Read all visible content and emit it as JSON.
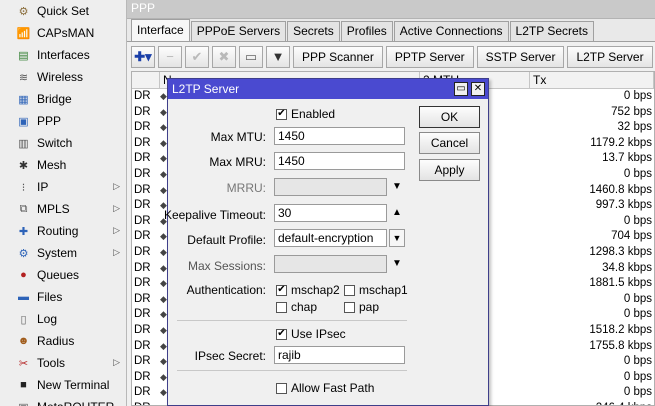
{
  "sidebar": {
    "items": [
      {
        "label": "Quick Set",
        "icon": "quick-set-icon",
        "glyph": "⚙",
        "color": "#8a6d3b",
        "arrow": false
      },
      {
        "label": "CAPsMAN",
        "icon": "capsman-icon",
        "glyph": "📶",
        "color": "#3a7a3a",
        "arrow": false
      },
      {
        "label": "Interfaces",
        "icon": "interfaces-icon",
        "glyph": "▤",
        "color": "#2f7d2f",
        "arrow": false
      },
      {
        "label": "Wireless",
        "icon": "wireless-icon",
        "glyph": "≋",
        "color": "#555555",
        "arrow": false
      },
      {
        "label": "Bridge",
        "icon": "bridge-icon",
        "glyph": "▦",
        "color": "#2d63b8",
        "arrow": false
      },
      {
        "label": "PPP",
        "icon": "ppp-icon",
        "glyph": "▣",
        "color": "#2d63b8",
        "arrow": false
      },
      {
        "label": "Switch",
        "icon": "switch-icon",
        "glyph": "▥",
        "color": "#555555",
        "arrow": false
      },
      {
        "label": "Mesh",
        "icon": "mesh-icon",
        "glyph": "✱",
        "color": "#333333",
        "arrow": false
      },
      {
        "label": "IP",
        "icon": "ip-icon",
        "glyph": "⁝",
        "color": "#555555",
        "arrow": true
      },
      {
        "label": "MPLS",
        "icon": "mpls-icon",
        "glyph": "⧉",
        "color": "#555555",
        "arrow": true
      },
      {
        "label": "Routing",
        "icon": "routing-icon",
        "glyph": "✚",
        "color": "#2d63b8",
        "arrow": true
      },
      {
        "label": "System",
        "icon": "system-icon",
        "glyph": "⚙",
        "color": "#2d63b8",
        "arrow": true
      },
      {
        "label": "Queues",
        "icon": "queues-icon",
        "glyph": "●",
        "color": "#b32020",
        "arrow": false
      },
      {
        "label": "Files",
        "icon": "files-icon",
        "glyph": "▬",
        "color": "#2d63b8",
        "arrow": false
      },
      {
        "label": "Log",
        "icon": "log-icon",
        "glyph": "▯",
        "color": "#666666",
        "arrow": false
      },
      {
        "label": "Radius",
        "icon": "radius-icon",
        "glyph": "☻",
        "color": "#a05b1a",
        "arrow": false
      },
      {
        "label": "Tools",
        "icon": "tools-icon",
        "glyph": "✂",
        "color": "#b32020",
        "arrow": true
      },
      {
        "label": "New Terminal",
        "icon": "terminal-icon",
        "glyph": "■",
        "color": "#222222",
        "arrow": false
      },
      {
        "label": "MetaROUTER",
        "icon": "metarouter-icon",
        "glyph": "▣",
        "color": "#555555",
        "arrow": false
      }
    ]
  },
  "window": {
    "title": "PPP"
  },
  "tabs": [
    "Interface",
    "PPPoE Servers",
    "Secrets",
    "Profiles",
    "Active Connections",
    "L2TP Secrets"
  ],
  "toolbar": {
    "add_glyph": "✚▾",
    "remove_glyph": "−",
    "enable_glyph": "✔",
    "disable_glyph": "✖",
    "comment_glyph": "▭",
    "filter_glyph": "▼",
    "buttons": [
      "PPP Scanner",
      "PPTP Server",
      "SSTP Server",
      "L2TP Server"
    ]
  },
  "table": {
    "headers": {
      "name": "N",
      "mtu": "2 MTU",
      "tx": "Tx"
    },
    "rows": [
      {
        "flag": "DR",
        "tx": "0 bps"
      },
      {
        "flag": "DR",
        "tx": "752 bps"
      },
      {
        "flag": "DR",
        "tx": "32 bps"
      },
      {
        "flag": "DR",
        "tx": "1179.2 kbps"
      },
      {
        "flag": "DR",
        "tx": "13.7 kbps"
      },
      {
        "flag": "DR",
        "tx": "0 bps"
      },
      {
        "flag": "DR",
        "tx": "1460.8 kbps"
      },
      {
        "flag": "DR",
        "tx": "997.3 kbps"
      },
      {
        "flag": "DR",
        "tx": "0 bps"
      },
      {
        "flag": "DR",
        "tx": "704 bps"
      },
      {
        "flag": "DR",
        "tx": "1298.3 kbps"
      },
      {
        "flag": "DR",
        "tx": "34.8 kbps"
      },
      {
        "flag": "DR",
        "tx": "1881.5 kbps"
      },
      {
        "flag": "DR",
        "tx": "0 bps"
      },
      {
        "flag": "DR",
        "tx": "0 bps"
      },
      {
        "flag": "DR",
        "tx": "1518.2 kbps"
      },
      {
        "flag": "DR",
        "tx": "1755.8 kbps"
      },
      {
        "flag": "DR",
        "tx": "0 bps"
      },
      {
        "flag": "DR",
        "tx": "0 bps"
      },
      {
        "flag": "DR",
        "tx": "0 bps"
      },
      {
        "flag": "DR",
        "tx": "246.4 kbps"
      }
    ]
  },
  "dialog": {
    "title": "L2TP Server",
    "enabled_label": "Enabled",
    "max_mtu_label": "Max MTU:",
    "max_mtu_value": "1450",
    "max_mru_label": "Max MRU:",
    "max_mru_value": "1450",
    "mrru_label": "MRRU:",
    "mrru_value": "",
    "keepalive_label": "Keepalive Timeout:",
    "keepalive_value": "30",
    "default_profile_label": "Default Profile:",
    "default_profile_value": "default-encryption",
    "max_sessions_label": "Max Sessions:",
    "max_sessions_value": "",
    "authentication_label": "Authentication:",
    "auth_mschap2": "mschap2",
    "auth_mschap1": "mschap1",
    "auth_chap": "chap",
    "auth_pap": "pap",
    "use_ipsec_label": "Use IPsec",
    "ipsec_secret_label": "IPsec Secret:",
    "ipsec_secret_value": "rajib",
    "allow_fast_path_label": "Allow Fast Path",
    "ok_label": "OK",
    "cancel_label": "Cancel",
    "apply_label": "Apply",
    "restore_glyph": "▭",
    "close_glyph": "✕"
  }
}
